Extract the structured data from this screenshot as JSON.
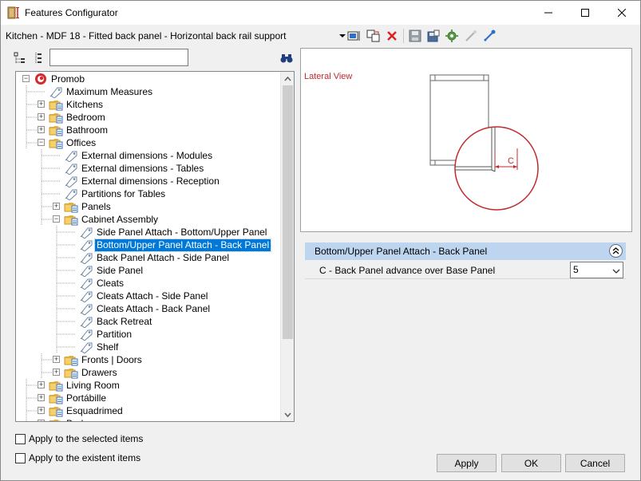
{
  "window": {
    "title": "Features Configurator"
  },
  "config": {
    "current": "Kitchen - MDF 18 - Fitted back panel - Horizontal back rail support"
  },
  "toolbar": {
    "icons": [
      "dropdown-arrow-icon",
      "insert-icon",
      "copy-icon",
      "delete-icon",
      "save-icon",
      "save-as-icon",
      "settings-icon",
      "link-icon",
      "connect-icon"
    ]
  },
  "search": {
    "value": "",
    "placeholder": ""
  },
  "tree": {
    "items": [
      {
        "label": "Promob",
        "level": 0,
        "expander": "minus",
        "icon": "promob-logo-icon"
      },
      {
        "label": "Maximum Measures",
        "level": 1,
        "expander": "",
        "icon": "tag-icon"
      },
      {
        "label": "Kitchens",
        "level": 1,
        "expander": "plus",
        "icon": "folder-icon"
      },
      {
        "label": "Bedroom",
        "level": 1,
        "expander": "plus",
        "icon": "folder-icon"
      },
      {
        "label": "Bathroom",
        "level": 1,
        "expander": "plus",
        "icon": "folder-icon"
      },
      {
        "label": "Offices",
        "level": 1,
        "expander": "minus",
        "icon": "folder-icon"
      },
      {
        "label": "External dimensions - Modules",
        "level": 2,
        "expander": "",
        "icon": "tag-icon"
      },
      {
        "label": "External dimensions - Tables",
        "level": 2,
        "expander": "",
        "icon": "tag-icon"
      },
      {
        "label": "External dimensions - Reception",
        "level": 2,
        "expander": "",
        "icon": "tag-icon"
      },
      {
        "label": "Partitions for Tables",
        "level": 2,
        "expander": "",
        "icon": "tag-icon"
      },
      {
        "label": "Panels",
        "level": 2,
        "expander": "plus",
        "icon": "folder-icon"
      },
      {
        "label": "Cabinet Assembly",
        "level": 2,
        "expander": "minus",
        "icon": "folder-icon"
      },
      {
        "label": "Side Panel Attach - Bottom/Upper Panel",
        "level": 3,
        "expander": "",
        "icon": "tag-icon"
      },
      {
        "label": "Bottom/Upper Panel Attach - Back Panel",
        "level": 3,
        "expander": "",
        "icon": "tag-icon",
        "selected": true
      },
      {
        "label": "Back Panel Attach - Side Panel",
        "level": 3,
        "expander": "",
        "icon": "tag-icon"
      },
      {
        "label": "Side Panel",
        "level": 3,
        "expander": "",
        "icon": "tag-icon"
      },
      {
        "label": "Cleats",
        "level": 3,
        "expander": "",
        "icon": "tag-icon"
      },
      {
        "label": "Cleats Attach - Side Panel",
        "level": 3,
        "expander": "",
        "icon": "tag-icon"
      },
      {
        "label": "Cleats Attach - Back Panel",
        "level": 3,
        "expander": "",
        "icon": "tag-icon"
      },
      {
        "label": "Back Retreat",
        "level": 3,
        "expander": "",
        "icon": "tag-icon"
      },
      {
        "label": "Partition",
        "level": 3,
        "expander": "",
        "icon": "tag-icon"
      },
      {
        "label": "Shelf",
        "level": 3,
        "expander": "",
        "icon": "tag-icon"
      },
      {
        "label": "Fronts | Doors",
        "level": 2,
        "expander": "plus",
        "icon": "folder-icon"
      },
      {
        "label": "Drawers",
        "level": 2,
        "expander": "plus",
        "icon": "folder-icon"
      },
      {
        "label": "Living Room",
        "level": 1,
        "expander": "plus",
        "icon": "folder-icon"
      },
      {
        "label": "Portábille",
        "level": 1,
        "expander": "plus",
        "icon": "folder-icon"
      },
      {
        "label": "Esquadrimed",
        "level": 1,
        "expander": "plus",
        "icon": "folder-icon"
      },
      {
        "label": "Bed",
        "level": 1,
        "expander": "plus",
        "icon": "folder-icon"
      }
    ]
  },
  "preview": {
    "label": "Lateral View",
    "dimension_label": "C",
    "accent": "#c0292e"
  },
  "properties": {
    "group_title": "Bottom/Upper Panel Attach - Back Panel",
    "rows": [
      {
        "name": "C - Back Panel advance over Base Panel",
        "value": "5"
      }
    ]
  },
  "options": {
    "apply_selected": "Apply to the selected items",
    "apply_existent": "Apply to the existent items"
  },
  "buttons": {
    "apply": "Apply",
    "ok": "OK",
    "cancel": "Cancel"
  },
  "colors": {
    "selection": "#0078d7",
    "header": "#bdd5ee",
    "delete": "#e02020"
  }
}
